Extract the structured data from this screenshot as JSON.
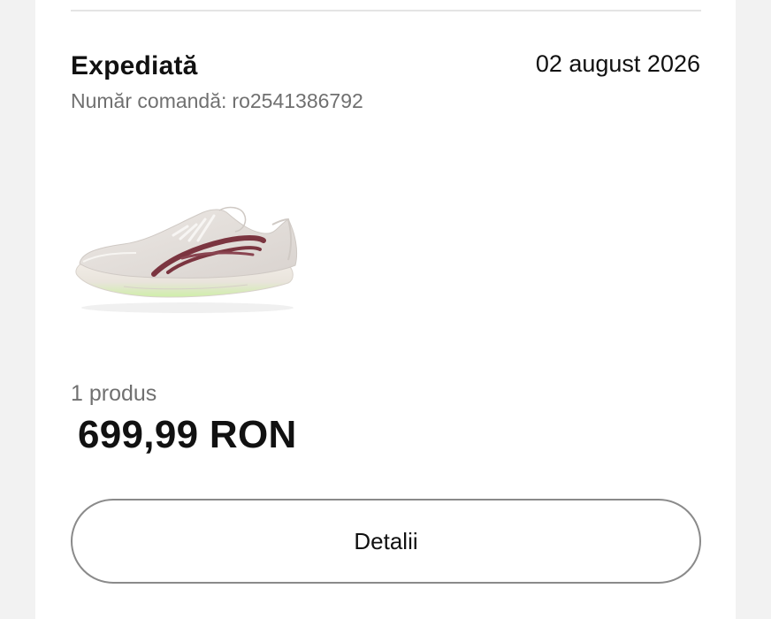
{
  "order": {
    "status": "Expediată",
    "date": "02 august 2026",
    "number_label": "Număr comandă:",
    "number_value": "ro2541386792",
    "item_count": "1 produs",
    "total": "699,99 RON",
    "details_label": "Detalii"
  },
  "product_image": {
    "depicts": "running-shoe",
    "colors": {
      "upper": "#e6e1dd",
      "logo_stripes": "#7b3540",
      "sole": "#ece6df",
      "sole_accent": "#c9ef9a"
    }
  }
}
